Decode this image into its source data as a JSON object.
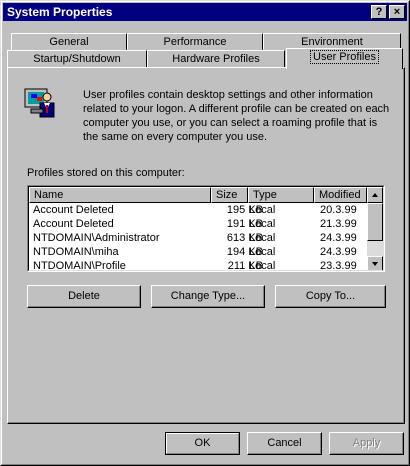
{
  "window": {
    "title": "System Properties",
    "help_label": "?",
    "close_label": "×"
  },
  "tabs": {
    "row1": [
      {
        "label": "General"
      },
      {
        "label": "Performance"
      },
      {
        "label": "Environment"
      }
    ],
    "row2": [
      {
        "label": "Startup/Shutdown"
      },
      {
        "label": "Hardware Profiles"
      },
      {
        "label": "User Profiles",
        "active": true
      }
    ]
  },
  "user_profiles": {
    "icon": "user-profile-icon",
    "description": "User profiles contain desktop settings and other information related to your logon.  A different profile can be created on each computer you use, or you can select a roaming profile that is the same on every computer you use.",
    "list_label": "Profiles stored on this computer:",
    "columns": [
      "Name",
      "Size",
      "Type",
      "Modified"
    ],
    "rows": [
      {
        "name": "Account Deleted",
        "size": "195 KB",
        "type": "Local",
        "modified": "20.3.99"
      },
      {
        "name": "Account Deleted",
        "size": "191 KB",
        "type": "Local",
        "modified": "21.3.99"
      },
      {
        "name": "NTDOMAIN\\Administrator",
        "size": "613 KB",
        "type": "Local",
        "modified": "24.3.99"
      },
      {
        "name": "NTDOMAIN\\miha",
        "size": "194 KB",
        "type": "Local",
        "modified": "24.3.99"
      },
      {
        "name": "NTDOMAIN\\Profile",
        "size": "211 KB",
        "type": "Local",
        "modified": "23.3.99"
      }
    ],
    "buttons": {
      "delete": "Delete",
      "change_type": "Change Type...",
      "copy_to": "Copy To..."
    }
  },
  "dialog_buttons": {
    "ok": "OK",
    "cancel": "Cancel",
    "apply": "Apply"
  },
  "colors": {
    "titlebar": "#000080",
    "face": "#c0c0c0"
  }
}
